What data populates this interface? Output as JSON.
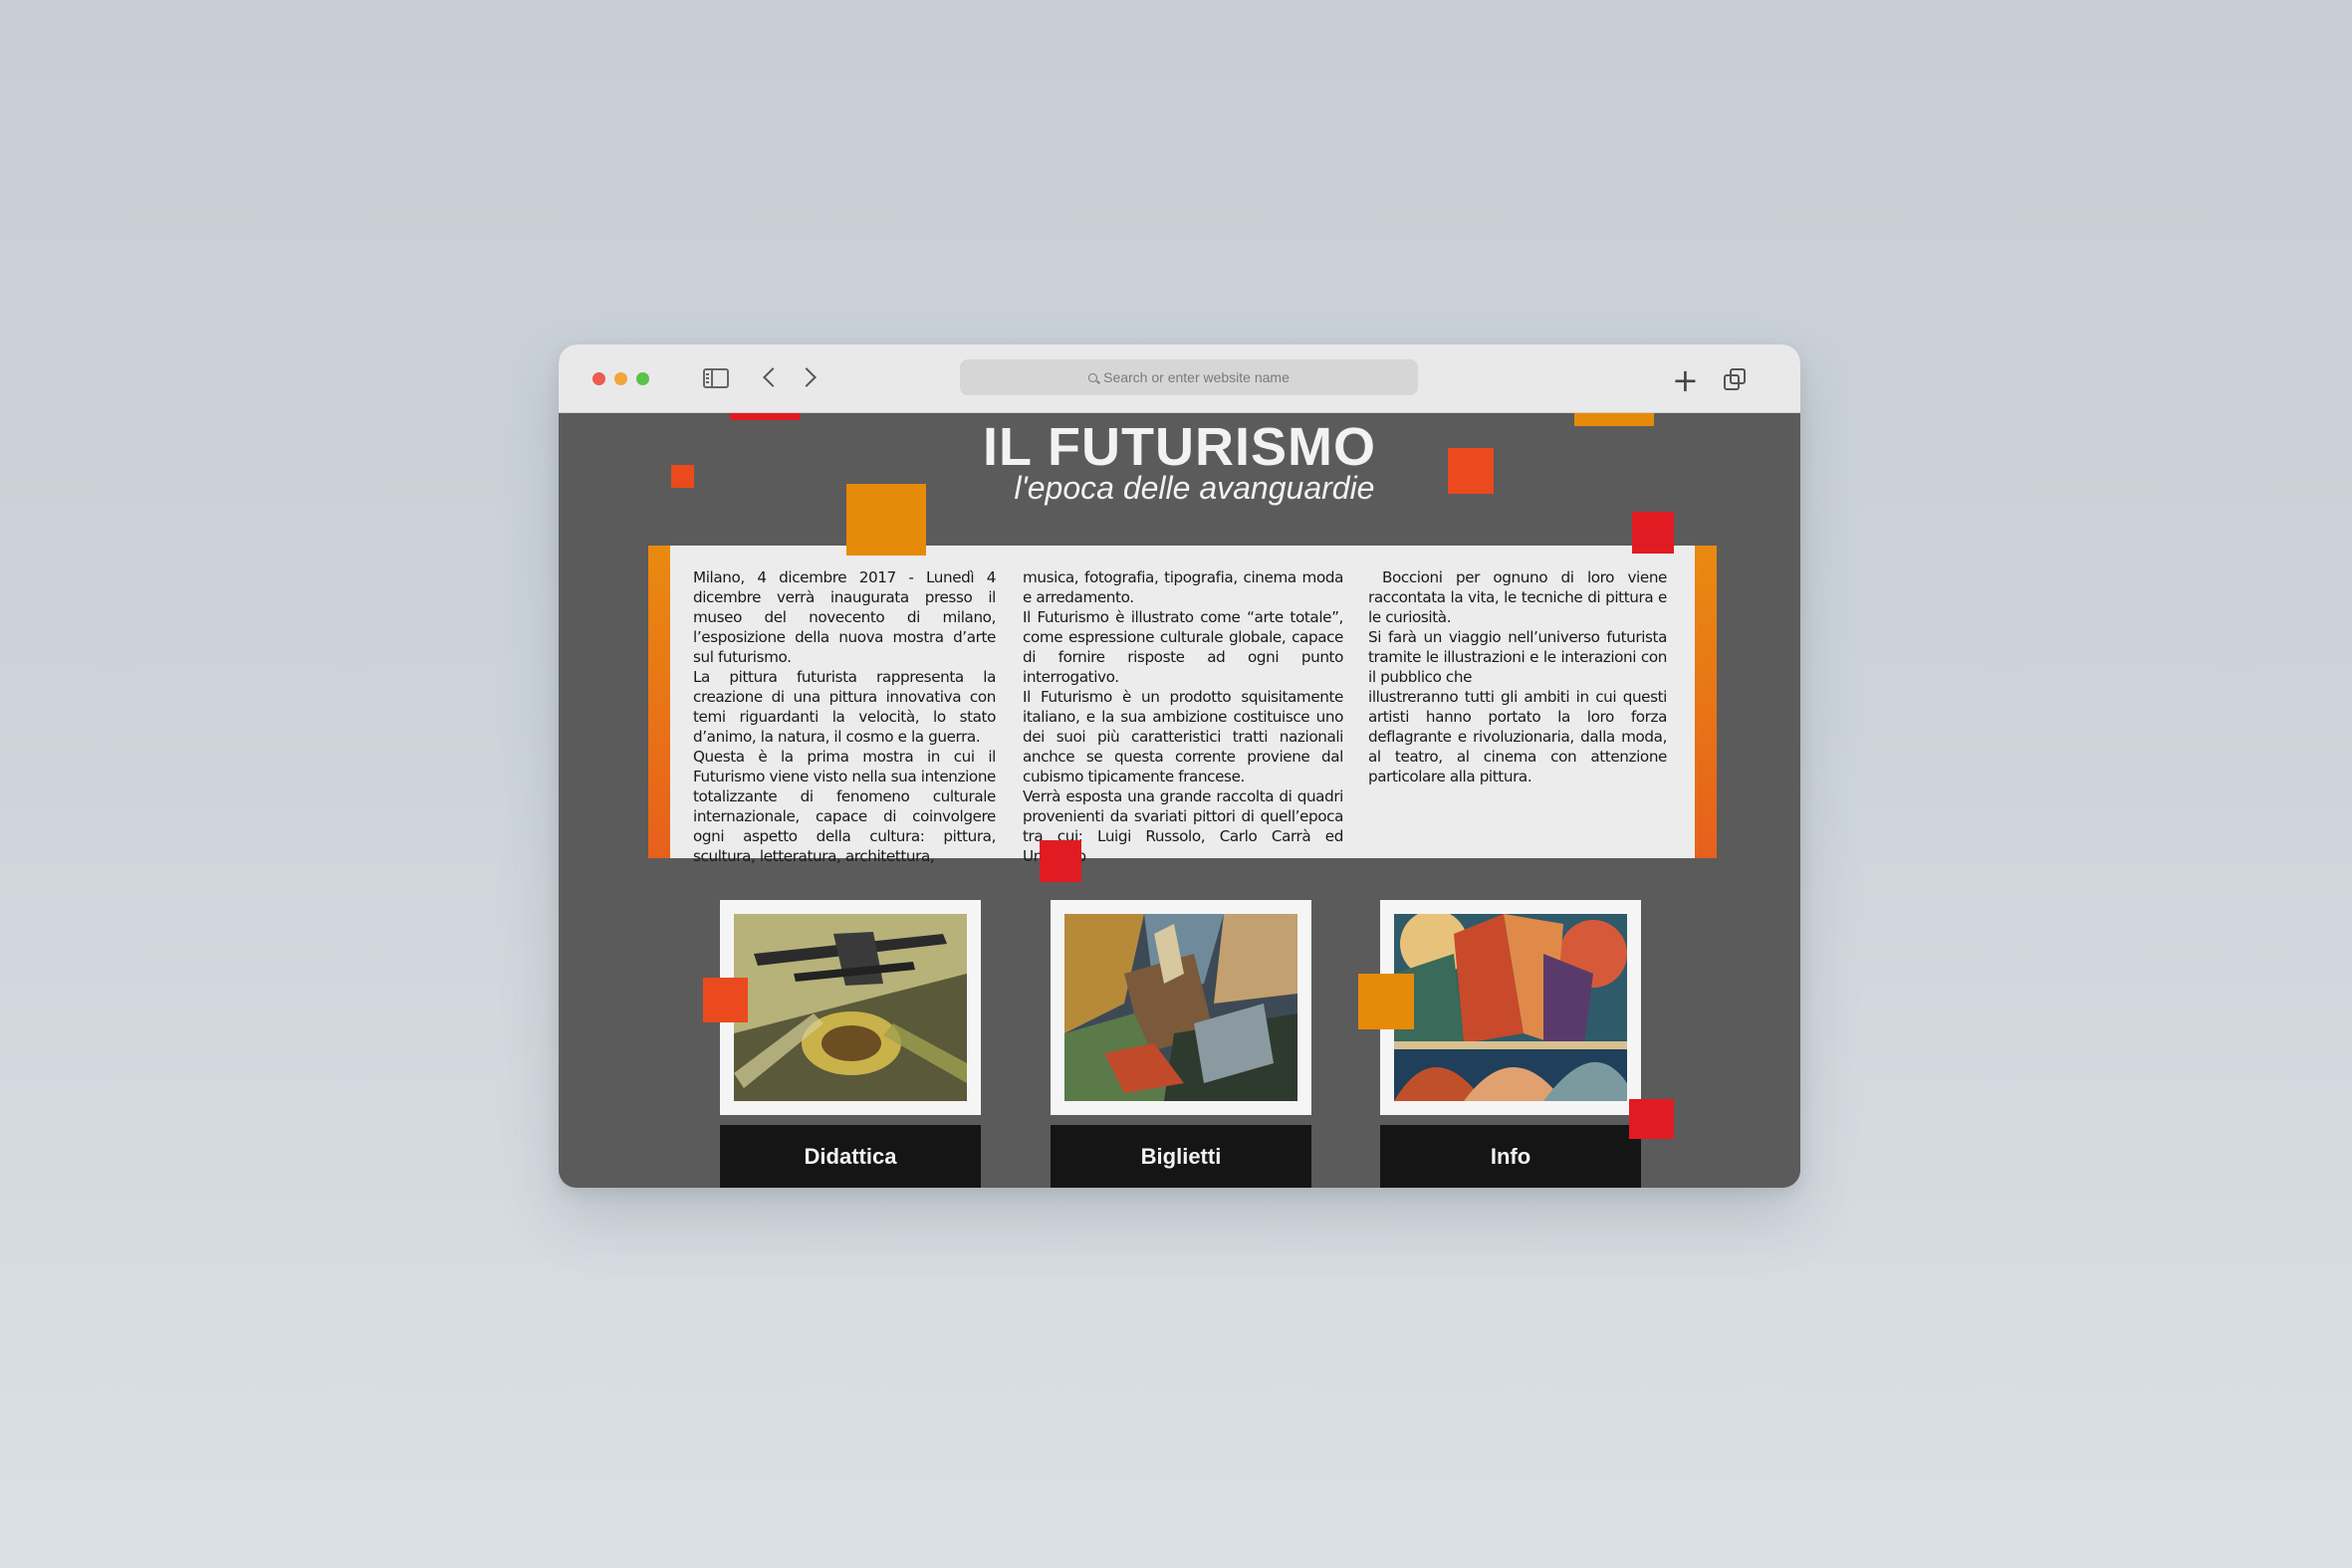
{
  "browser": {
    "url_placeholder": "Search or enter website name"
  },
  "page": {
    "title": "IL FUTURISMO",
    "subtitle": "l'epoca delle avanguardie",
    "columns": [
      [
        "Milano, 4 dicembre 2017 - Lunedì 4 dicembre verrà inaugurata presso il museo del novecento di milano, l’esposizione della nuova mostra d’arte sul futurismo.",
        "La pittura futurista rappresenta la creazione di una pittura innovativa con temi riguardanti la velocità, lo stato d’animo, la natura, il cosmo e la guerra.",
        "Questa è la prima mostra in cui il Futurismo viene visto nella sua intenzione totalizzante di fenomeno culturale internazionale, capace di coinvolgere ogni aspetto della cultura: pittura, scultura, letteratura, architettura,"
      ],
      [
        "musica, fotografia, tipografia, cinema moda e arredamento.",
        "Il Futurismo è illustrato come “arte totale”, come espressione culturale globale, capace di fornire risposte ad ogni punto interrogativo.",
        "Il Futurismo è un prodotto squisitamente italiano, e la sua ambizione costituisce uno dei suoi più caratteristici tratti nazionali anchce se questa corrente proviene dal cubismo tipicamente francese.",
        "Verrà esposta una grande raccolta di quadri provenienti da svariati pittori di quell’epoca tra cui:  Luigi Russolo, Carlo Carrà ed Umberto"
      ],
      [
        "Boccioni per ognuno di loro viene raccontata la vita, le tecniche di pittura e le curiosità.",
        "Si farà un viaggio nell’universo futurista tramite le illustrazioni e le interazioni con il pubblico che",
        "illustreranno tutti gli ambiti in cui questi artisti hanno portato la loro forza deflagrante e rivoluzionaria, dalla moda, al teatro, al cinema con attenzione particolare alla pittura."
      ]
    ],
    "cards": [
      {
        "label": "Didattica"
      },
      {
        "label": "Biglietti"
      },
      {
        "label": "Info"
      }
    ]
  },
  "colors": {
    "red": "#e11b22",
    "orange_red": "#ea4a1e",
    "orange": "#e68a0a",
    "background": "#5b5b5b"
  }
}
